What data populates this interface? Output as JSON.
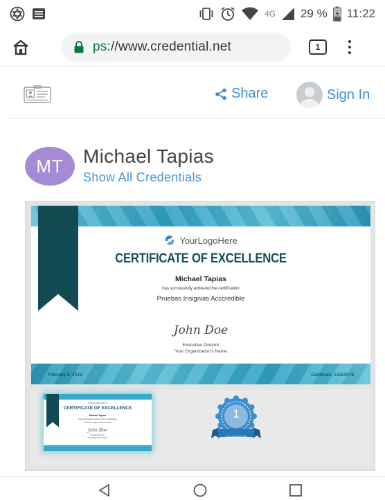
{
  "status_bar": {
    "network": "4G",
    "battery": "29 %",
    "time": "11:22"
  },
  "browser": {
    "url_scheme": "ps:",
    "url_rest": "//www.credential.net",
    "tab_count": "1"
  },
  "header": {
    "share_label": "Share",
    "signin_label": "Sign In"
  },
  "profile": {
    "initials": "MT",
    "name": "Michael Tapias",
    "show_all_label": "Show All Credentials"
  },
  "certificate": {
    "logo_text": "YourLogoHere",
    "title": "CERTIFICATE OF EXCELLENCE",
    "recipient": "Michael Tapias",
    "achieved_text": "has successfully achieved the certification",
    "program": "Pruebas Insignias Acccredible",
    "signature": "John Doe",
    "signer_role": "Executive Director",
    "organization": "Your Organization's Name",
    "date": "February 5, 2019",
    "certificate_number": "Certificate: 12510078"
  },
  "thumbnail": {
    "logo_text": "Your Logo Here",
    "title": "CERTIFICATE OF EXCELLENCE",
    "recipient": "Michael Tapias",
    "achieved_text": "has successfully achieved the certification",
    "program": "Pruebas Insignias Acccredible",
    "signature": "John Doe",
    "signer_role": "Executive Director",
    "organization": "Your Organization's Name"
  },
  "badge": {
    "number": "1",
    "label": "Congratulations"
  },
  "colors": {
    "link": "#3a8fd8",
    "avatar": "#a48bd6",
    "cert_title": "#14505c",
    "ribbon": "#134b55",
    "band": "#3aa8c8",
    "badge": "#3b8fd0"
  }
}
